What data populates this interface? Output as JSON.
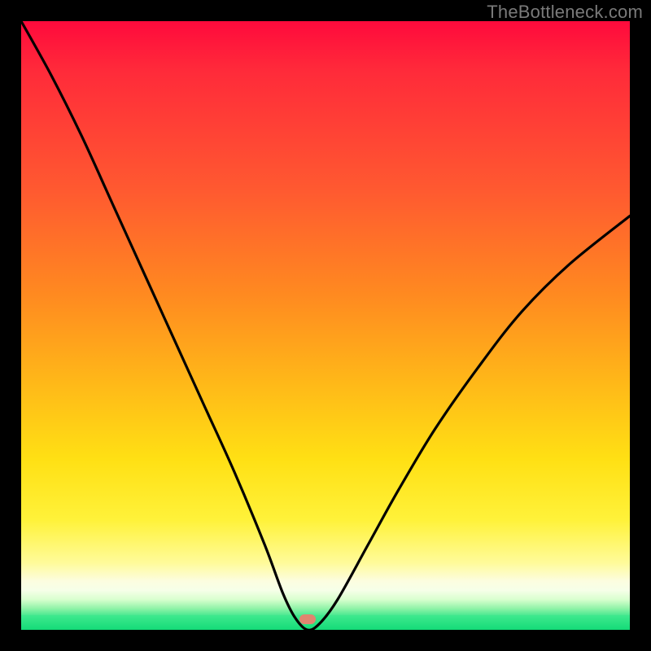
{
  "attribution": "TheBottleneck.com",
  "marker": {
    "color": "#e0856f",
    "x_pct": 47,
    "y_pct": 98.3
  },
  "chart_data": {
    "type": "line",
    "title": "",
    "xlabel": "",
    "ylabel": "",
    "xlim": [
      0,
      100
    ],
    "ylim": [
      0,
      100
    ],
    "grid": false,
    "legend": false,
    "comment": "x is relative component balance (0..100, center ~47 is balanced). y is bottleneck severity percentage (0 = no bottleneck, 100 = severe). Values are read from the curve shape against the plot area.",
    "series": [
      {
        "name": "bottleneck-curve",
        "x": [
          0,
          5,
          10,
          15,
          20,
          25,
          30,
          35,
          40,
          43,
          45,
          47,
          49,
          52,
          57,
          62,
          68,
          75,
          82,
          90,
          100
        ],
        "y": [
          100,
          91,
          81,
          70,
          59,
          48,
          37,
          26,
          14,
          6,
          2,
          0,
          1,
          5,
          14,
          23,
          33,
          43,
          52,
          60,
          68
        ]
      }
    ],
    "background_gradient_stops": [
      {
        "pct": 0,
        "color": "#ff0a3c"
      },
      {
        "pct": 28,
        "color": "#ff5a30"
      },
      {
        "pct": 60,
        "color": "#ffba18"
      },
      {
        "pct": 82,
        "color": "#fff23a"
      },
      {
        "pct": 92,
        "color": "#fcfde0"
      },
      {
        "pct": 100,
        "color": "#18df7e"
      }
    ],
    "marker": {
      "x": 47,
      "y": 0,
      "color": "#e0856f"
    }
  }
}
